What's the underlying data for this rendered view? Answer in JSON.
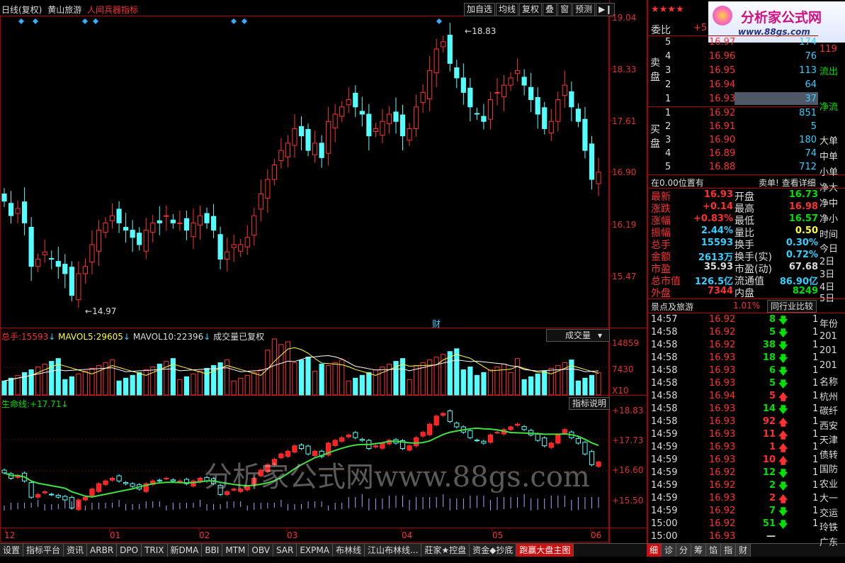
{
  "title_bar": {
    "period": "日线(复权)",
    "stock": "黄山旅游",
    "indicator": "人间兵器指标"
  },
  "toolbar": [
    "加自选",
    "均线",
    "复权",
    "叠",
    "窗",
    "预测"
  ],
  "price_axis": [
    "19.04",
    "18.33",
    "17.61",
    "16.90",
    "16.19",
    "15.47"
  ],
  "annotations": {
    "high": "18.83",
    "low": "14.97",
    "fin_marker": "财"
  },
  "volume_panel": {
    "label_total": "总手:",
    "total": "15593",
    "label_mavol5": "MAVOL5:",
    "mavol5": "29605",
    "label_mavol10": "MAVOL10:",
    "mavol10": "22396",
    "note": "成交量已复权",
    "selector": "成交量",
    "axis": [
      "14859",
      "7430",
      "X10"
    ]
  },
  "life_panel": {
    "label": "生命线:",
    "value": "+17.71",
    "help": "指标说明",
    "axis": [
      "+18.83",
      "+17.73",
      "+16.60",
      "+15.50"
    ]
  },
  "watermark": "分析家公式网www.88gs.com",
  "x_axis": [
    "12",
    "01",
    "02",
    "03",
    "04",
    "05",
    "06"
  ],
  "bottom_tabs": [
    "设置",
    "指标平台",
    "资讯",
    "ARBR",
    "DPO",
    "TRIX",
    "新DMA",
    "BBI",
    "MTM",
    "OBV",
    "SAR",
    "EXPMA",
    "布林线",
    "江山布林线...",
    "莊家★控盘",
    "资金◆抄底",
    "跑赢大盘主图"
  ],
  "right_tabs": [
    "细",
    "诊",
    "分",
    "筹",
    "馅",
    "指",
    "财"
  ],
  "logo": {
    "stars": "★★★★",
    "text": "分析家公式网",
    "url": "www.88gs.com"
  },
  "order_book": {
    "ratio_label": "委比",
    "ratio_value": "+5",
    "sell_label": [
      "卖",
      "盘"
    ],
    "buy_label": [
      "买",
      "盘"
    ],
    "sell": [
      {
        "lv": "5",
        "price": "16.97",
        "vol": "174"
      },
      {
        "lv": "4",
        "price": "16.96",
        "vol": "76"
      },
      {
        "lv": "3",
        "price": "16.95",
        "vol": "113"
      },
      {
        "lv": "2",
        "price": "16.94",
        "vol": "64"
      },
      {
        "lv": "1",
        "price": "16.93",
        "vol": "37"
      }
    ],
    "buy": [
      {
        "lv": "1",
        "price": "16.92",
        "vol": "851"
      },
      {
        "lv": "2",
        "price": "16.91",
        "vol": "5"
      },
      {
        "lv": "3",
        "price": "16.90",
        "vol": "180"
      },
      {
        "lv": "4",
        "price": "16.89",
        "vol": "74"
      },
      {
        "lv": "5",
        "price": "16.88",
        "vol": "712"
      }
    ],
    "side_cut": [
      "119",
      "流出",
      "净流",
      "大单",
      "中单",
      "小单",
      "净大",
      "净中",
      "净小",
      "时间",
      "今日",
      "2日",
      "3日",
      "4日",
      "5日"
    ]
  },
  "position_bar": {
    "left": "在0.00位置有",
    "right": "卖单! 查看详细"
  },
  "quote": [
    {
      "l": "最新",
      "lv": "16.93",
      "lc": "red",
      "r": "开盘",
      "rv": "16.73",
      "rc": "green"
    },
    {
      "l": "涨跌",
      "lv": "+0.14",
      "lc": "red",
      "r": "最高",
      "rv": "16.98",
      "rc": "red"
    },
    {
      "l": "涨幅",
      "lv": "+0.83%",
      "lc": "red",
      "r": "最低",
      "rv": "16.57",
      "rc": "green"
    },
    {
      "l": "振幅",
      "lv": "2.44%",
      "lc": "cyan",
      "r": "量比",
      "rv": "0.50",
      "rc": "yellow"
    },
    {
      "l": "总手",
      "lv": "15593",
      "lc": "cyan",
      "r": "换手",
      "rv": "0.30%",
      "rc": "cyan"
    },
    {
      "l": "金额",
      "lv": "2613万",
      "lc": "cyan",
      "r": "换手(实)",
      "rv": "0.72%",
      "rc": "cyan"
    },
    {
      "l": "市盈",
      "lv": "35.93",
      "lc": "white",
      "r": "市盈(动)",
      "rv": "67.68",
      "rc": "white"
    },
    {
      "l": "总市值",
      "lv": "126.5亿",
      "lc": "cyan",
      "r": "流通值",
      "rv": "86.90亿",
      "rc": "cyan"
    },
    {
      "l": "外盘",
      "lv": "7344",
      "lc": "red",
      "r": "内盘",
      "rv": "8249",
      "rc": "green"
    }
  ],
  "sector": {
    "name": "景点及旅游",
    "pct": "1.01%",
    "compare": "同行业比较"
  },
  "ticks": [
    {
      "t": "14:57",
      "p": "16.92",
      "v": "8",
      "d": "down"
    },
    {
      "t": "14:58",
      "p": "16.92",
      "v": "5",
      "d": "down"
    },
    {
      "t": "14:58",
      "p": "16.92",
      "v": "38",
      "d": "down"
    },
    {
      "t": "14:58",
      "p": "16.93",
      "v": "18",
      "d": "down"
    },
    {
      "t": "14:58",
      "p": "16.93",
      "v": "6",
      "d": "down"
    },
    {
      "t": "14:58",
      "p": "16.93",
      "v": "5",
      "d": "down"
    },
    {
      "t": "14:58",
      "p": "16.94",
      "v": "5",
      "d": "up"
    },
    {
      "t": "14:58",
      "p": "16.93",
      "v": "14",
      "d": "down"
    },
    {
      "t": "14:58",
      "p": "16.93",
      "v": "92",
      "d": "up"
    },
    {
      "t": "14:59",
      "p": "16.93",
      "v": "11",
      "d": "up"
    },
    {
      "t": "14:59",
      "p": "16.93",
      "v": "1",
      "d": "up"
    },
    {
      "t": "14:59",
      "p": "16.93",
      "v": "10",
      "d": "up"
    },
    {
      "t": "14:59",
      "p": "16.92",
      "v": "12",
      "d": "down"
    },
    {
      "t": "14:59",
      "p": "16.92",
      "v": "2",
      "d": "down"
    },
    {
      "t": "14:59",
      "p": "16.93",
      "v": "2",
      "d": "up"
    },
    {
      "t": "14:59",
      "p": "16.92",
      "v": "7",
      "d": "down"
    },
    {
      "t": "15:00",
      "p": "16.92",
      "v": "51",
      "d": "down"
    },
    {
      "t": "15:00",
      "p": "16.93",
      "v": "—",
      "d": "none"
    }
  ],
  "tick_side_cut": [
    "年份",
    "201",
    "201",
    "201",
    "名称",
    "杭州",
    "碳纤",
    "西安",
    "天津",
    "债转",
    "国防",
    "农业",
    "大一",
    "交运",
    "玲铁",
    "广东"
  ],
  "chart_data": {
    "type": "candlestick",
    "price_range": [
      14.97,
      18.83
    ],
    "x_ticks": [
      "12",
      "01",
      "02",
      "03",
      "04",
      "05",
      "06"
    ],
    "last_close": 16.93,
    "indicators": [
      "MAVOL5",
      "MAVOL10",
      "生命线"
    ]
  }
}
